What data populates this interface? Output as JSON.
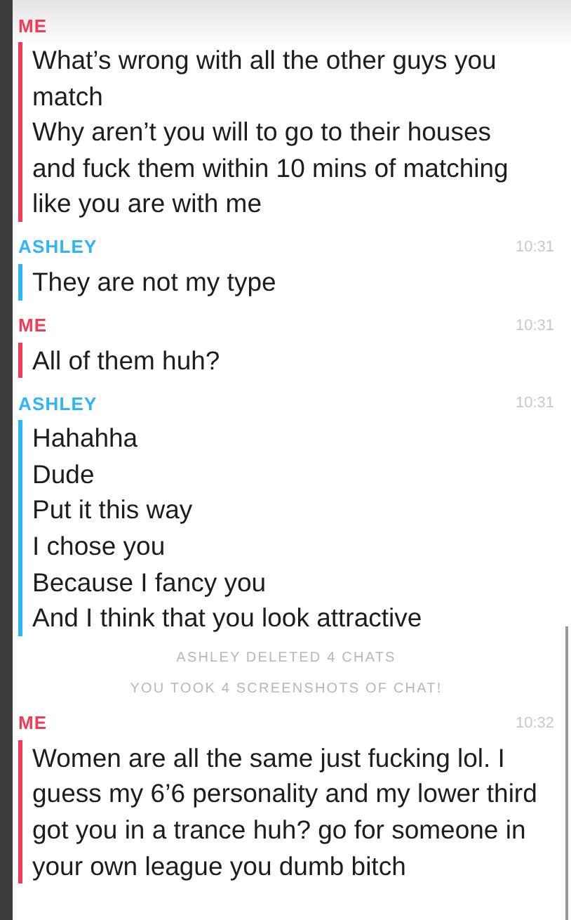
{
  "messages": [
    {
      "kind": "message",
      "sender": "ME",
      "color": "#f23c57",
      "lines": [
        "What’s wrong with all the other guys you match",
        "Why aren’t you will to go to their houses",
        "and fuck them within 10 mins of matching",
        "like you are with me"
      ]
    },
    {
      "kind": "message",
      "sender": "ASHLEY",
      "color": "#2fb5f3",
      "time": "10:31",
      "lines": [
        "They are not my type"
      ]
    },
    {
      "kind": "message",
      "sender": "ME",
      "color": "#f23c57",
      "time": "10:31",
      "lines": [
        "All of them huh?"
      ]
    },
    {
      "kind": "message",
      "sender": "ASHLEY",
      "color": "#2fb5f3",
      "time": "10:31",
      "lines": [
        "Hahahha",
        "Dude",
        "Put it this way",
        "I chose you",
        "Because I fancy you",
        "And I think that you look attractive"
      ]
    },
    {
      "kind": "notice",
      "text": "ASHLEY DELETED 4 CHATS"
    },
    {
      "kind": "notice",
      "text": "YOU TOOK 4 SCREENSHOTS OF CHAT!"
    },
    {
      "kind": "message",
      "sender": "ME",
      "color": "#f23c57",
      "time": "10:32",
      "lines": [
        "Women are all the same just fucking lol. I guess my 6’6 personality and my lower third got you in a trance huh? go for someone in your own league you dumb bitch"
      ]
    }
  ]
}
